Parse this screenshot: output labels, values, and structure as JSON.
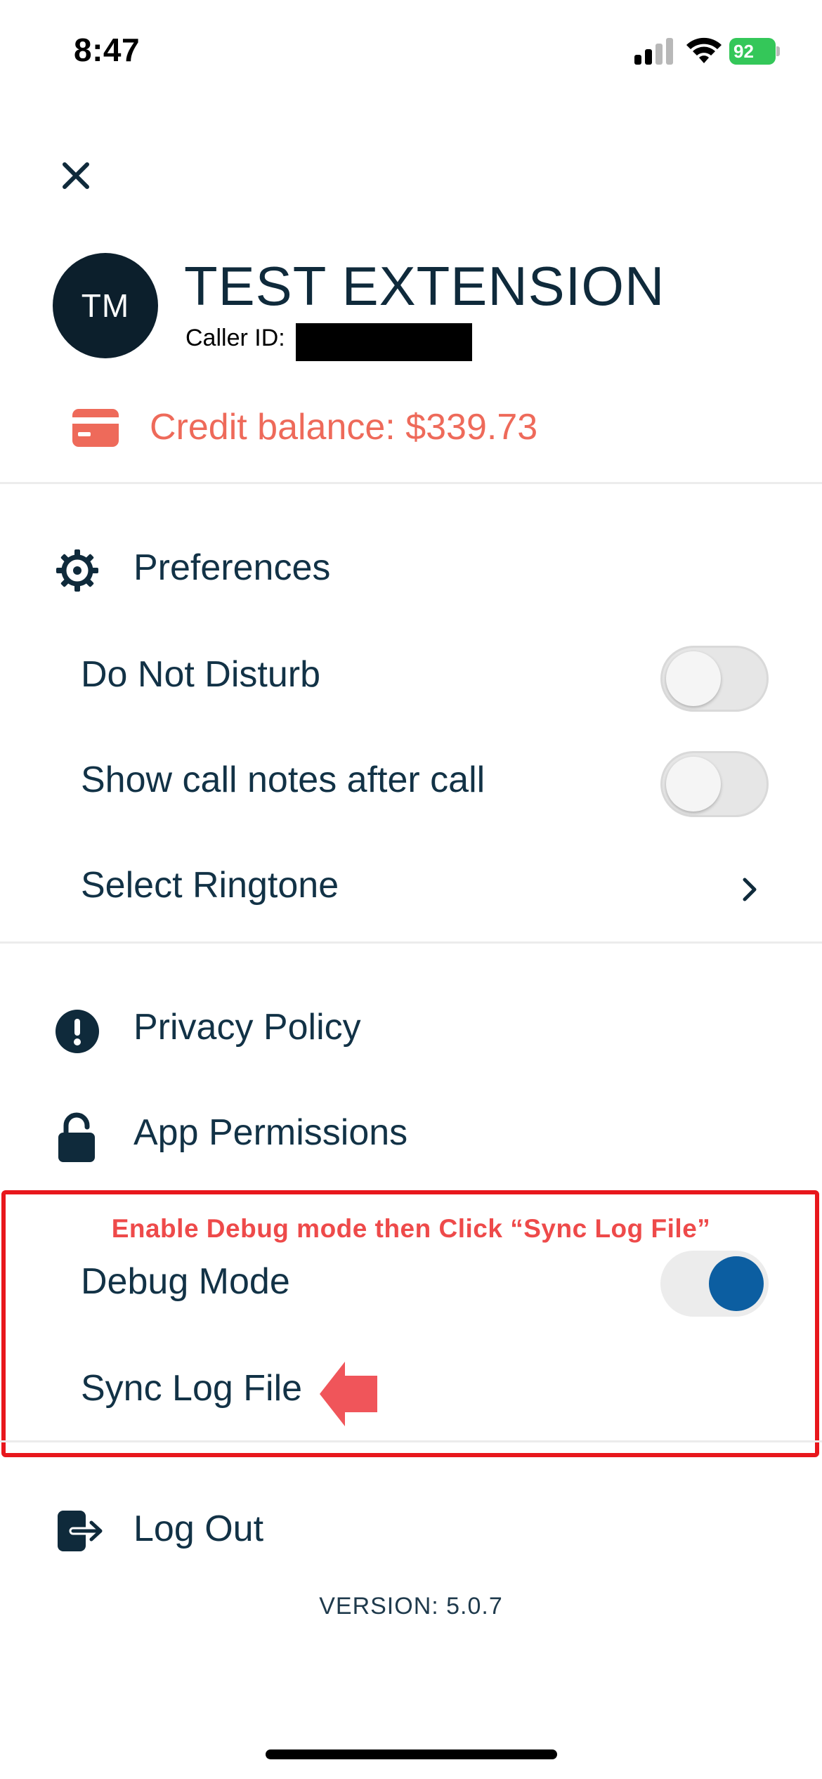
{
  "status_bar": {
    "time": "8:47",
    "battery_percent": "92"
  },
  "profile": {
    "initials": "TM",
    "name": "TEST EXTENSION",
    "caller_id_label": "Caller ID:",
    "caller_id_value": "[redacted]"
  },
  "credit": {
    "label": "Credit balance: $339.73"
  },
  "preferences": {
    "title": "Preferences",
    "items": [
      {
        "label": "Do Not Disturb",
        "enabled": false
      },
      {
        "label": "Show call notes after call",
        "enabled": false
      },
      {
        "label": "Select Ringtone"
      }
    ]
  },
  "links": {
    "privacy_policy": "Privacy Policy",
    "app_permissions": "App Permissions"
  },
  "annotation": {
    "text": "Enable Debug mode then Click “Sync Log File”",
    "color": "#ee4a4a"
  },
  "debug": {
    "debug_mode_label": "Debug Mode",
    "debug_mode_enabled": true,
    "sync_log_label": "Sync Log File"
  },
  "logout": {
    "label": "Log Out"
  },
  "version": "VERSION: 5.0.7",
  "colors": {
    "accent_red": "#ee6a5a",
    "toggle_on": "#0c5ea1",
    "navy": "#0c1f2c"
  }
}
